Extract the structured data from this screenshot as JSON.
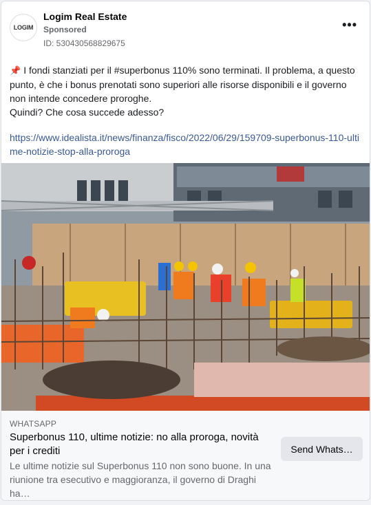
{
  "post": {
    "page_name": "Logim Real Estate",
    "sponsored_label": "Sponsored",
    "ad_id": "ID: 530430568829675",
    "logo_text": "LOGIM",
    "more_label": "•••",
    "body_line1": "I fondi stanziati per il #superbonus 110% sono terminati. Il problema, a questo punto, è che i bonus prenotati sono superiori alle risorse disponibili e il governo non intende concedere proroghe.",
    "body_line2": "Quindi? Che cosa succede adesso?",
    "link": "https://www.idealista.it/news/finanza/fisco/2022/06/29/159709-superbonus-110-ultime-notizie-stop-alla-proroga"
  },
  "preview": {
    "source": "WHATSAPP",
    "headline": "Superbonus 110, ultime notizie: no alla proroga, novità per i crediti",
    "description": "Le ultime notizie sul Superbonus 110 non sono buone. In una riunione tra esecutivo e maggioranza, il governo di Draghi ha…",
    "cta_label": "Send Whats…"
  },
  "colors": {
    "link": "#385898",
    "muted": "#65676b",
    "footer_bg": "#f7f8fa",
    "cta_bg": "#e4e6eb"
  }
}
